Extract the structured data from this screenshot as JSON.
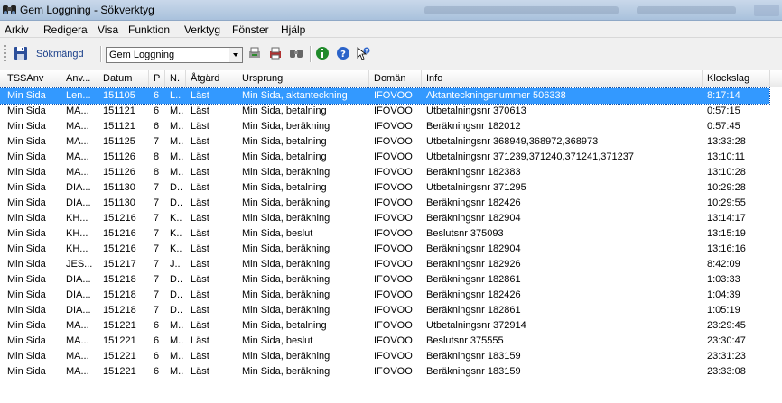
{
  "window": {
    "title": "Gem Loggning - Sökverktyg"
  },
  "menu": [
    "Arkiv",
    "Redigera",
    "Visa",
    "Funktion",
    "Verktyg",
    "Fönster",
    "Hjälp"
  ],
  "toolbar": {
    "search_label": "Sökmängd",
    "combo_value": "Gem Loggning",
    "icons": [
      "save-icon",
      "export-icon",
      "print-icon",
      "binoculars-icon",
      "info-icon",
      "help-icon",
      "whats-this-icon"
    ]
  },
  "table": {
    "columns": [
      "TSSAnv",
      "Anv...",
      "Datum",
      "P",
      "N.",
      "Åtgärd",
      "Ursprung",
      "Domän",
      "Info",
      "Klockslag"
    ],
    "selected_row": 0,
    "rows": [
      [
        "Min Sida",
        "Len...",
        "151105",
        "6",
        "L..",
        "Läst",
        "Min Sida, aktanteckning",
        "IFOVOO",
        "Aktanteckningsnummer 506338",
        "8:17:14"
      ],
      [
        "Min Sida",
        "MA...",
        "151121",
        "6",
        "M..",
        "Läst",
        "Min Sida, betalning",
        "IFOVOO",
        "Utbetalningsnr 370613",
        "0:57:15"
      ],
      [
        "Min Sida",
        "MA...",
        "151121",
        "6",
        "M..",
        "Läst",
        "Min Sida, beräkning",
        "IFOVOO",
        "Beräkningsnr 182012",
        "0:57:45"
      ],
      [
        "Min Sida",
        "MA...",
        "151125",
        "7",
        "M..",
        "Läst",
        "Min Sida, betalning",
        "IFOVOO",
        "Utbetalningsnr 368949,368972,368973",
        "13:33:28"
      ],
      [
        "Min Sida",
        "MA...",
        "151126",
        "8",
        "M..",
        "Läst",
        "Min Sida, betalning",
        "IFOVOO",
        "Utbetalningsnr 371239,371240,371241,371237",
        "13:10:11"
      ],
      [
        "Min Sida",
        "MA...",
        "151126",
        "8",
        "M..",
        "Läst",
        "Min Sida, beräkning",
        "IFOVOO",
        "Beräkningsnr 182383",
        "13:10:28"
      ],
      [
        "Min Sida",
        "DIA...",
        "151130",
        "7",
        "D..",
        "Läst",
        "Min Sida, betalning",
        "IFOVOO",
        "Utbetalningsnr 371295",
        "10:29:28"
      ],
      [
        "Min Sida",
        "DIA...",
        "151130",
        "7",
        "D..",
        "Läst",
        "Min Sida, beräkning",
        "IFOVOO",
        "Beräkningsnr 182426",
        "10:29:55"
      ],
      [
        "Min Sida",
        "KH...",
        "151216",
        "7",
        "K..",
        "Läst",
        "Min Sida, beräkning",
        "IFOVOO",
        "Beräkningsnr 182904",
        "13:14:17"
      ],
      [
        "Min Sida",
        "KH...",
        "151216",
        "7",
        "K..",
        "Läst",
        "Min Sida, beslut",
        "IFOVOO",
        "Beslutsnr 375093",
        "13:15:19"
      ],
      [
        "Min Sida",
        "KH...",
        "151216",
        "7",
        "K..",
        "Läst",
        "Min Sida, beräkning",
        "IFOVOO",
        "Beräkningsnr 182904",
        "13:16:16"
      ],
      [
        "Min Sida",
        "JES...",
        "151217",
        "7",
        "J..",
        "Läst",
        "Min Sida, beräkning",
        "IFOVOO",
        "Beräkningsnr 182926",
        "8:42:09"
      ],
      [
        "Min Sida",
        "DIA...",
        "151218",
        "7",
        "D..",
        "Läst",
        "Min Sida, beräkning",
        "IFOVOO",
        "Beräkningsnr 182861",
        "1:03:33"
      ],
      [
        "Min Sida",
        "DIA...",
        "151218",
        "7",
        "D..",
        "Läst",
        "Min Sida, beräkning",
        "IFOVOO",
        "Beräkningsnr 182426",
        "1:04:39"
      ],
      [
        "Min Sida",
        "DIA...",
        "151218",
        "7",
        "D..",
        "Läst",
        "Min Sida, beräkning",
        "IFOVOO",
        "Beräkningsnr 182861",
        "1:05:19"
      ],
      [
        "Min Sida",
        "MA...",
        "151221",
        "6",
        "M..",
        "Läst",
        "Min Sida, betalning",
        "IFOVOO",
        "Utbetalningsnr 372914",
        "23:29:45"
      ],
      [
        "Min Sida",
        "MA...",
        "151221",
        "6",
        "M..",
        "Läst",
        "Min Sida, beslut",
        "IFOVOO",
        "Beslutsnr 375555",
        "23:30:47"
      ],
      [
        "Min Sida",
        "MA...",
        "151221",
        "6",
        "M..",
        "Läst",
        "Min Sida, beräkning",
        "IFOVOO",
        "Beräkningsnr 183159",
        "23:31:23"
      ],
      [
        "Min Sida",
        "MA...",
        "151221",
        "6",
        "M..",
        "Läst",
        "Min Sida, beräkning",
        "IFOVOO",
        "Beräkningsnr 183159",
        "23:33:08"
      ]
    ]
  },
  "colors": {
    "selection": "#3399ff",
    "toolbar_label": "#1a3f8a"
  }
}
